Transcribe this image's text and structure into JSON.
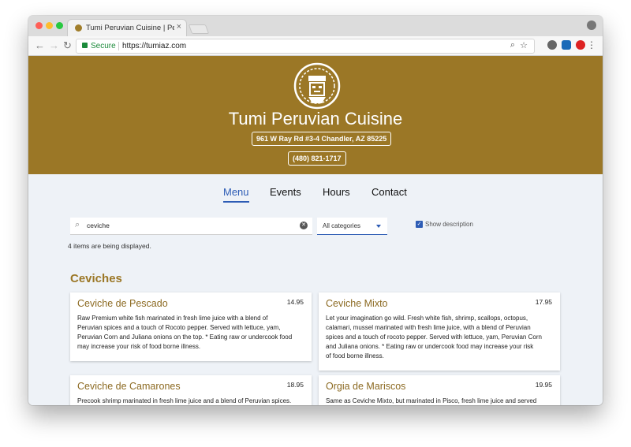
{
  "browser": {
    "tab_title": "Tumi Peruvian Cuisine | Peruvia",
    "tab_close": "×",
    "secure_label": "Secure",
    "url": "https://tumiaz.com",
    "icons": [
      "back-icon",
      "forward-icon",
      "reload-icon",
      "search-icon",
      "star-icon",
      "gear-icon",
      "extension-icon",
      "adblock-icon",
      "menu-icon",
      "profile-icon"
    ]
  },
  "hero": {
    "name": "Tumi Peruvian Cuisine",
    "address": "961 W Ray Rd #3-4 Chandler, AZ 85225",
    "phone": "(480) 821-1717",
    "bg_color": "#9b7726"
  },
  "nav": {
    "menu": "Menu",
    "events": "Events",
    "hours": "Hours",
    "contact": "Contact",
    "active_color": "#2d5cb5"
  },
  "filters": {
    "search_value": "ceviche",
    "category": "All categories",
    "show_description": "Show description",
    "show_description_checked": true,
    "count_text": "4 items are being displayed."
  },
  "section": {
    "title": "Ceviches",
    "items": [
      {
        "name": "Ceviche de Pescado",
        "price": "14.95",
        "desc": [
          "Raw Premium white fish marinated in fresh lime juice with a blend of",
          "Peruvian spices and a touch of Rocoto pepper. Served with lettuce, yam,",
          "Peruvian Corn and Juliana onions on the top. * Eating raw or undercook food",
          "may increase your risk of food borne illness."
        ]
      },
      {
        "name": "Ceviche Mixto",
        "price": "17.95",
        "desc": [
          "Let your imagination go wild. Fresh white fish, shrimp, scallops, octopus,",
          "calamari, mussel marinated with fresh lime juice, with a blend of Peruvian",
          "spices and a touch of rocoto pepper. Served with lettuce, yam, Peruvian Corn",
          "and Juliana onions. * Eating raw or undercook food may increase your risk",
          "of food borne illness."
        ]
      },
      {
        "name": "Ceviche de Camarones",
        "price": "18.95",
        "desc": [
          "Precook shrimp marinated in fresh lime juice and a blend of Peruvian spices."
        ]
      },
      {
        "name": "Orgia de Mariscos",
        "price": "19.95",
        "desc": [
          "Same as Ceviche Mixto, but marinated in Pisco, fresh lime juice and served"
        ]
      }
    ]
  }
}
